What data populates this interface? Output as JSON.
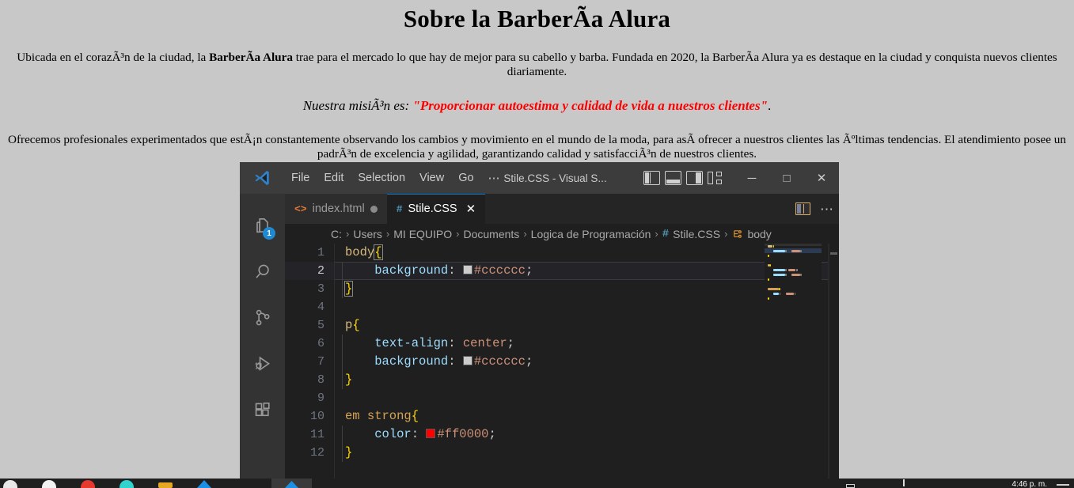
{
  "webpage": {
    "title": "Sobre la BarberÃ­a Alura",
    "paragraph1": {
      "pre": "Ubicada en el corazÃ³n de la ciudad, la ",
      "bold": "BarberÃ­a Alura",
      "post": " trae para el mercado lo que hay de mejor para su cabello y barba. Fundada en 2020, la BarberÃ­a Alura ya es destaque en la ciudad y conquista nuevos clientes diariamente."
    },
    "mission": {
      "lead": "Nuestra misiÃ³n es: ",
      "quote": "\"Proporcionar autoestima y calidad de vida a nuestros clientes\"",
      "tail": "."
    },
    "paragraph2": "Ofrecemos profesionales experimentados que estÃ¡n constantemente observando los cambios y movimiento en el mundo de la moda, para asÃ­ ofrecer a nuestros clientes las Ãºltimas tendencias. El atendimiento posee un padrÃ³n de excelencia y agilidad, garantizando calidad y satisfacciÃ³n de nuestros clientes.",
    "accent_red": "#ff0000",
    "background": "#c8c8c8"
  },
  "taskbar": {
    "clock": "4:46 p. m.",
    "icons": [
      "windows-start-icon",
      "search-icon",
      "red-app-icon",
      "teal-app-icon",
      "folder-icon",
      "blue-app-icon"
    ],
    "active_icon": "vscode-taskbar-icon"
  },
  "vscode": {
    "titlebar": {
      "logo": "vscode-logo-icon",
      "menus": [
        "File",
        "Edit",
        "Selection",
        "View",
        "Go",
        "⋯"
      ],
      "window_title": "Stile.CSS - Visual S...",
      "layout_icons": [
        "toggle-primary-sidebar-icon",
        "toggle-panel-icon",
        "toggle-secondary-sidebar-icon",
        "customize-layout-icon"
      ],
      "controls": {
        "minimize": "─",
        "maximize": "□",
        "close": "✕"
      }
    },
    "activitybar": {
      "items": [
        {
          "name": "explorer-icon",
          "badge": "1"
        },
        {
          "name": "search-icon",
          "badge": ""
        },
        {
          "name": "source-control-icon",
          "badge": ""
        },
        {
          "name": "run-and-debug-icon",
          "badge": ""
        },
        {
          "name": "extensions-icon",
          "badge": ""
        }
      ]
    },
    "tabs": [
      {
        "label": "index.html",
        "icon": "html-file-icon",
        "icon_glyph": "<>",
        "dirty": true,
        "active": false,
        "close": ""
      },
      {
        "label": "Stile.CSS",
        "icon": "css-file-icon",
        "icon_glyph": "#",
        "dirty": false,
        "active": true,
        "close": "✕"
      }
    ],
    "tab_actions": {
      "split_editor": "split-editor-icon",
      "more_actions": "⋯"
    },
    "breadcrumb": {
      "separator": "›",
      "items": [
        "C:",
        "Users",
        "MI EQUIPO",
        "Documents",
        "Logica de Programación"
      ],
      "file": "Stile.CSS",
      "file_icon_glyph": "#",
      "symbol": "body",
      "symbol_icon": "css-selector-symbol-icon"
    },
    "editor": {
      "active_line": 2,
      "language": "CSS",
      "lines": [
        {
          "n": 1,
          "tokens": [
            {
              "t": "body",
              "c": "sel"
            },
            {
              "t": "{",
              "c": "brace-match"
            }
          ]
        },
        {
          "n": 2,
          "tokens": [
            {
              "t": "    ",
              "c": "punc"
            },
            {
              "t": "background",
              "c": "prop"
            },
            {
              "t": ":",
              "c": "punc"
            },
            {
              "t": " ",
              "c": "punc"
            },
            {
              "t": "swatch:#cccccc",
              "c": "swatch"
            },
            {
              "t": "#cccccc",
              "c": "val"
            },
            {
              "t": ";",
              "c": "punc"
            }
          ]
        },
        {
          "n": 3,
          "tokens": [
            {
              "t": "}",
              "c": "brace-match"
            }
          ]
        },
        {
          "n": 4,
          "tokens": []
        },
        {
          "n": 5,
          "tokens": [
            {
              "t": "p",
              "c": "sel"
            },
            {
              "t": "{",
              "c": "brace"
            }
          ]
        },
        {
          "n": 6,
          "tokens": [
            {
              "t": "    ",
              "c": "punc"
            },
            {
              "t": "text-align",
              "c": "prop"
            },
            {
              "t": ":",
              "c": "punc"
            },
            {
              "t": " ",
              "c": "punc"
            },
            {
              "t": "center",
              "c": "val"
            },
            {
              "t": ";",
              "c": "punc"
            }
          ]
        },
        {
          "n": 7,
          "tokens": [
            {
              "t": "    ",
              "c": "punc"
            },
            {
              "t": "background",
              "c": "prop"
            },
            {
              "t": ":",
              "c": "punc"
            },
            {
              "t": " ",
              "c": "punc"
            },
            {
              "t": "swatch:#cccccc",
              "c": "swatch"
            },
            {
              "t": "#cccccc",
              "c": "val"
            },
            {
              "t": ";",
              "c": "punc"
            }
          ]
        },
        {
          "n": 8,
          "tokens": [
            {
              "t": "}",
              "c": "brace"
            }
          ]
        },
        {
          "n": 9,
          "tokens": []
        },
        {
          "n": 10,
          "tokens": [
            {
              "t": "em strong",
              "c": "tagsel"
            },
            {
              "t": "{",
              "c": "brace"
            }
          ]
        },
        {
          "n": 11,
          "tokens": [
            {
              "t": "    ",
              "c": "punc"
            },
            {
              "t": "color",
              "c": "prop"
            },
            {
              "t": ":",
              "c": "punc"
            },
            {
              "t": " ",
              "c": "punc"
            },
            {
              "t": "swatch:#ff0000",
              "c": "swatch"
            },
            {
              "t": "#ff0000",
              "c": "val"
            },
            {
              "t": ";",
              "c": "punc"
            }
          ]
        },
        {
          "n": 12,
          "tokens": [
            {
              "t": "}",
              "c": "brace"
            }
          ]
        }
      ],
      "colors_referenced": [
        "#cccccc",
        "#ff0000"
      ]
    },
    "theme": {
      "titlebar_bg": "#3c3c3c",
      "activitybar_bg": "#333333",
      "tabbar_bg": "#252526",
      "editor_bg": "#1f1f1f",
      "accent": "#0078d4",
      "badge_bg": "#1f8ad2"
    }
  }
}
